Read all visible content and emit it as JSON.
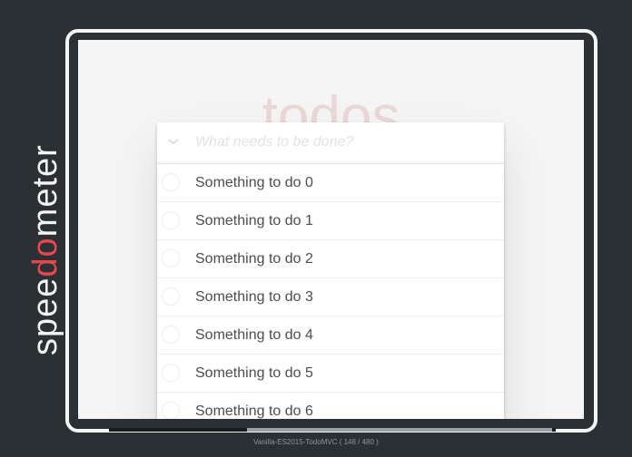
{
  "logo": {
    "text_pre": "spee",
    "text_accent": "do",
    "text_post": "meter",
    "colors": {
      "main": "#f4f4f4",
      "accent": "#e8484b"
    }
  },
  "app": {
    "title": "todos",
    "new_todo_placeholder": "What needs to be done?",
    "toggle_all_icon": "chevron-down",
    "items": [
      {
        "label": "Something to do 0",
        "completed": false
      },
      {
        "label": "Something to do 1",
        "completed": false
      },
      {
        "label": "Something to do 2",
        "completed": false
      },
      {
        "label": "Something to do 3",
        "completed": false
      },
      {
        "label": "Something to do 4",
        "completed": false
      },
      {
        "label": "Something to do 5",
        "completed": false
      },
      {
        "label": "Something to do 6",
        "completed": false
      }
    ]
  },
  "footer": {
    "caption": "Vanilla-ES2015-TodoMVC ( 148 / 480 )"
  },
  "colors": {
    "background": "#2b3034",
    "title": "#e8d0d0",
    "item_text": "#4d4d4d",
    "placeholder": "#e3e3e3"
  }
}
